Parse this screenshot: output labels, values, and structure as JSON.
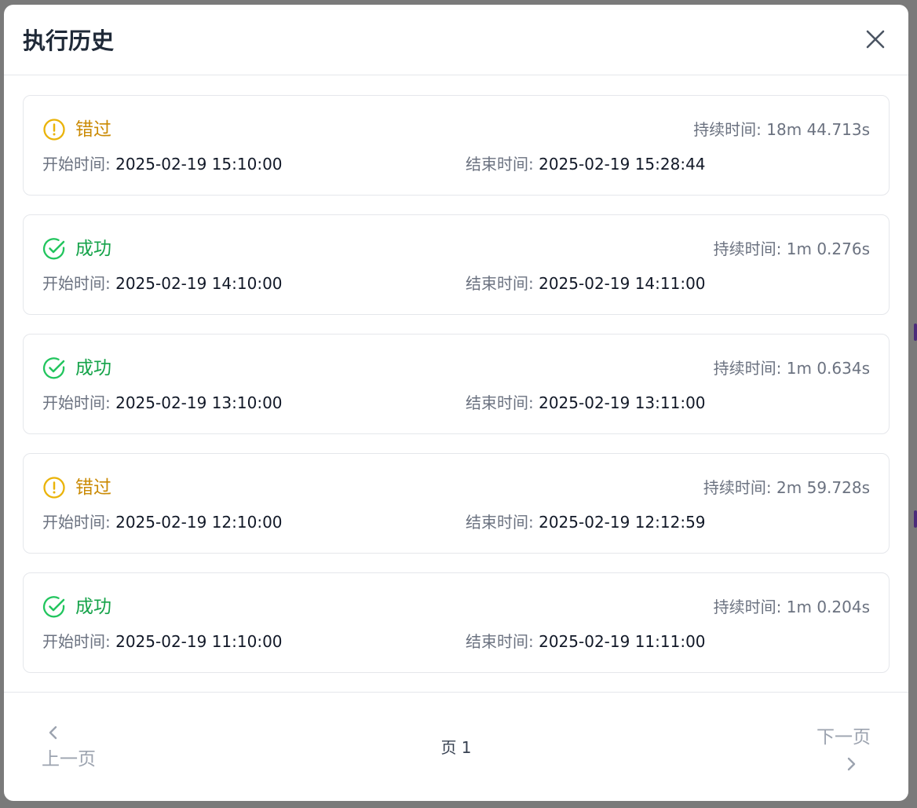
{
  "dialog": {
    "title": "执行历史",
    "close_icon": "close-icon"
  },
  "runs": [
    {
      "status": "错过",
      "status_type": "missed",
      "status_icon": "alert-circle-icon",
      "duration_label": "持续时间:",
      "duration": "18m 44.713s",
      "start_label": "开始时间:",
      "start": "2025-02-19 15:10:00",
      "end_label": "结束时间:",
      "end": "2025-02-19 15:28:44"
    },
    {
      "status": "成功",
      "status_type": "success",
      "status_icon": "check-circle-icon",
      "duration_label": "持续时间:",
      "duration": "1m 0.276s",
      "start_label": "开始时间:",
      "start": "2025-02-19 14:10:00",
      "end_label": "结束时间:",
      "end": "2025-02-19 14:11:00"
    },
    {
      "status": "成功",
      "status_type": "success",
      "status_icon": "check-circle-icon",
      "duration_label": "持续时间:",
      "duration": "1m 0.634s",
      "start_label": "开始时间:",
      "start": "2025-02-19 13:10:00",
      "end_label": "结束时间:",
      "end": "2025-02-19 13:11:00"
    },
    {
      "status": "错过",
      "status_type": "missed",
      "status_icon": "alert-circle-icon",
      "duration_label": "持续时间:",
      "duration": "2m 59.728s",
      "start_label": "开始时间:",
      "start": "2025-02-19 12:10:00",
      "end_label": "结束时间:",
      "end": "2025-02-19 12:12:59"
    },
    {
      "status": "成功",
      "status_type": "success",
      "status_icon": "check-circle-icon",
      "duration_label": "持续时间:",
      "duration": "1m 0.204s",
      "start_label": "开始时间:",
      "start": "2025-02-19 11:10:00",
      "end_label": "结束时间:",
      "end": "2025-02-19 11:11:00"
    }
  ],
  "pagination": {
    "prev_label": "上一页",
    "next_label": "下一页",
    "page_label": "页 1",
    "prev_icon": "chevron-left-icon",
    "next_icon": "chevron-right-icon"
  },
  "colors": {
    "missed": "#ca8a04",
    "missed_icon": "#eab308",
    "success": "#16a34a",
    "success_icon": "#22c55e",
    "muted": "#6b7280",
    "disabled": "#9ca3af",
    "border": "#e5e7eb"
  }
}
